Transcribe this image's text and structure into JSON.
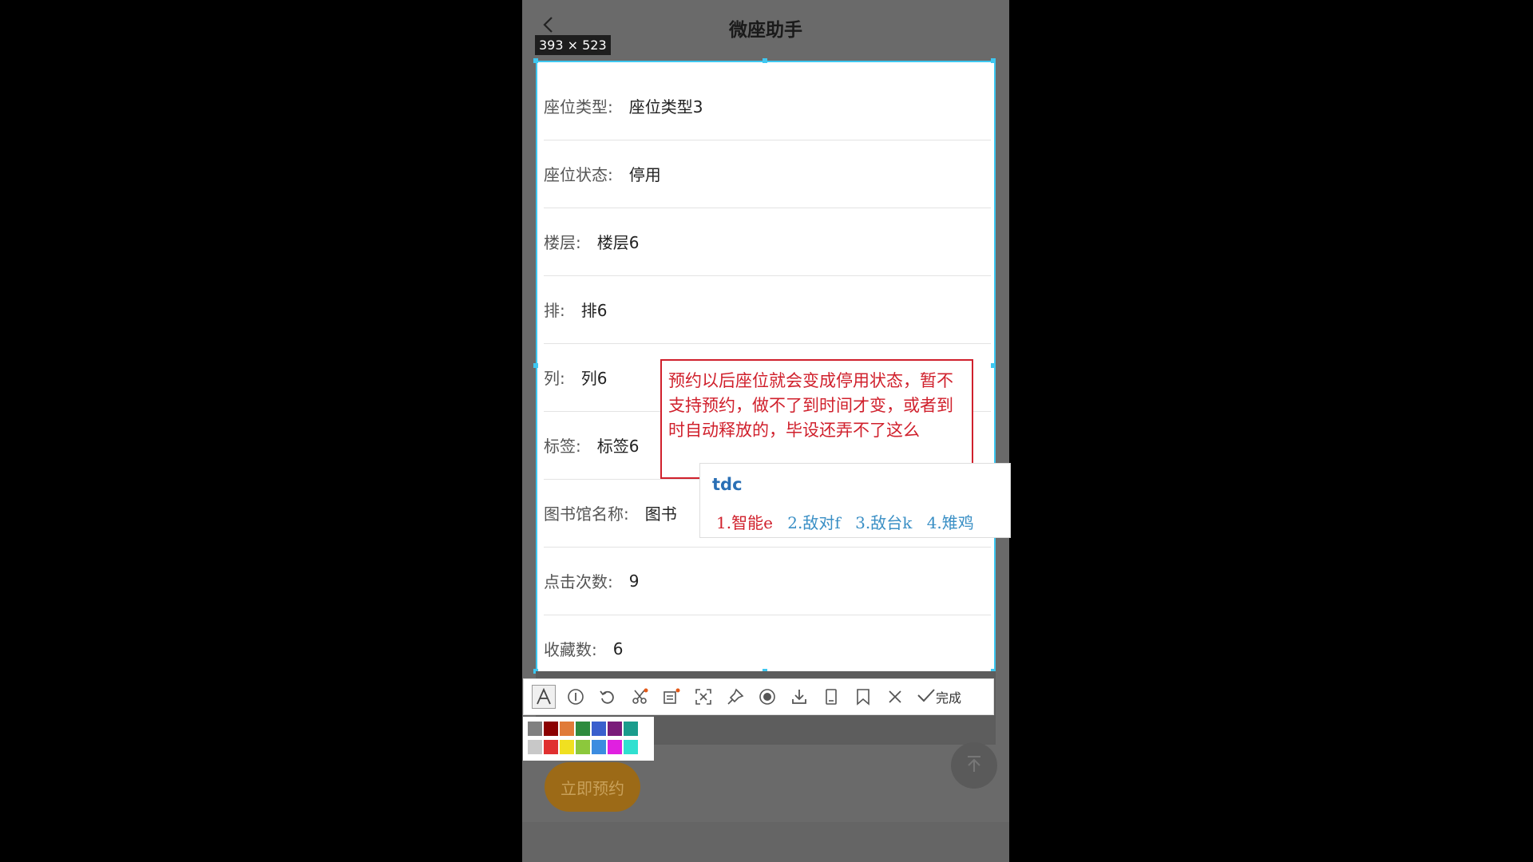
{
  "app": {
    "title": "微座助手"
  },
  "selection": {
    "size_label": "393 × 523"
  },
  "fields": [
    {
      "label": "座位类型:",
      "value": "座位类型3"
    },
    {
      "label": "座位状态:",
      "value": "停用"
    },
    {
      "label": "楼层:",
      "value": "楼层6"
    },
    {
      "label": "排:",
      "value": "排6"
    },
    {
      "label": "列:",
      "value": "列6"
    },
    {
      "label": "标签:",
      "value": "标签6"
    },
    {
      "label": "图书馆名称:",
      "value": "图书"
    },
    {
      "label": "点击次数:",
      "value": "9"
    },
    {
      "label": "收藏数:",
      "value": "6"
    }
  ],
  "annotation": {
    "text": "预约以后座位就会变成停用状态，暂不支持预约，做不了到时间才变，或者到时自动释放的，毕设还弄不了这么"
  },
  "ime": {
    "input": "tdc",
    "candidates": [
      "1.智能e",
      "2.敌对f",
      "3.敌台k",
      "4.雉鸡"
    ]
  },
  "toolbar": {
    "done_label": "完成",
    "tools": [
      "text-icon",
      "number-icon",
      "undo-icon",
      "cut-icon",
      "ocr-icon",
      "region-icon",
      "pin-icon",
      "record-icon",
      "download-icon",
      "save-icon",
      "bookmark-icon",
      "close-icon",
      "check-icon"
    ]
  },
  "palette": {
    "row1": [
      "#808080",
      "#8b0000",
      "#e07b39",
      "#2e8b3e",
      "#3a5fcd",
      "#7a1c7a",
      "#1a9c8c"
    ],
    "row2": [
      "#c8c8c8",
      "#e03030",
      "#f0e020",
      "#8cc83c",
      "#3c8ce0",
      "#e020e0",
      "#30e0d0"
    ]
  },
  "bottom": {
    "reserve_label": "立即预约"
  }
}
